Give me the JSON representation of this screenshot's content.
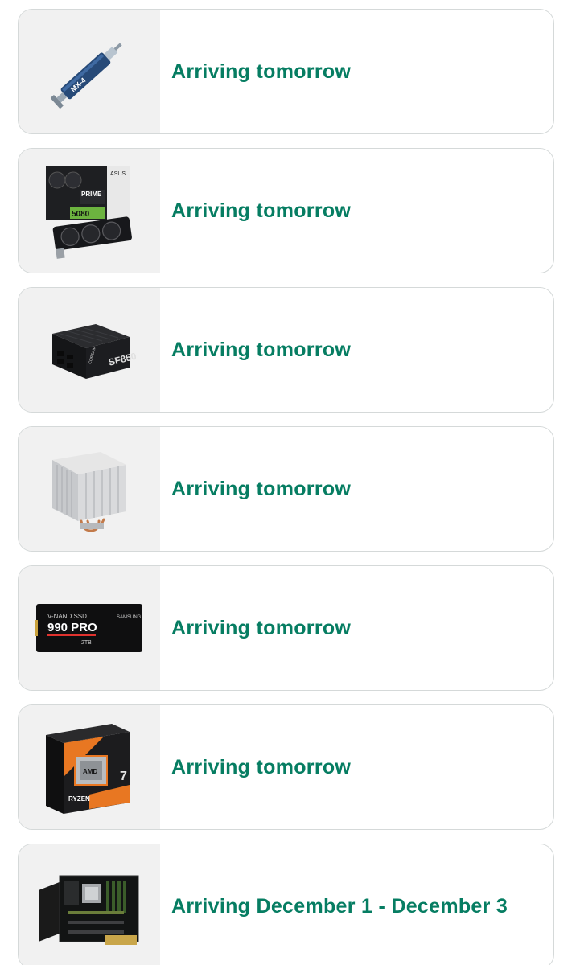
{
  "orders": [
    {
      "status": "Arriving tomorrow",
      "product_icon": "thermal-paste-syringe-icon",
      "image_text": [
        "MX-4"
      ]
    },
    {
      "status": "Arriving tomorrow",
      "product_icon": "graphics-card-icon",
      "image_text": [
        "PRIME",
        "5080",
        "ASUS"
      ]
    },
    {
      "status": "Arriving tomorrow",
      "product_icon": "power-supply-icon",
      "image_text": [
        "SF850",
        "CORSAIR"
      ]
    },
    {
      "status": "Arriving tomorrow",
      "product_icon": "cpu-cooler-icon",
      "image_text": []
    },
    {
      "status": "Arriving tomorrow",
      "product_icon": "nvme-ssd-icon",
      "image_text": [
        "V-NAND SSD",
        "990 PRO",
        "2TB",
        "SAMSUNG"
      ]
    },
    {
      "status": "Arriving tomorrow",
      "product_icon": "cpu-box-icon",
      "image_text": [
        "AMD",
        "RYZEN",
        "7"
      ]
    },
    {
      "status": "Arriving December 1 - December 3",
      "product_icon": "motherboard-icon",
      "image_text": []
    }
  ],
  "colors": {
    "status_text": "#067d62",
    "card_border": "#d5d9d9",
    "thumb_bg": "#f1f1f1"
  }
}
